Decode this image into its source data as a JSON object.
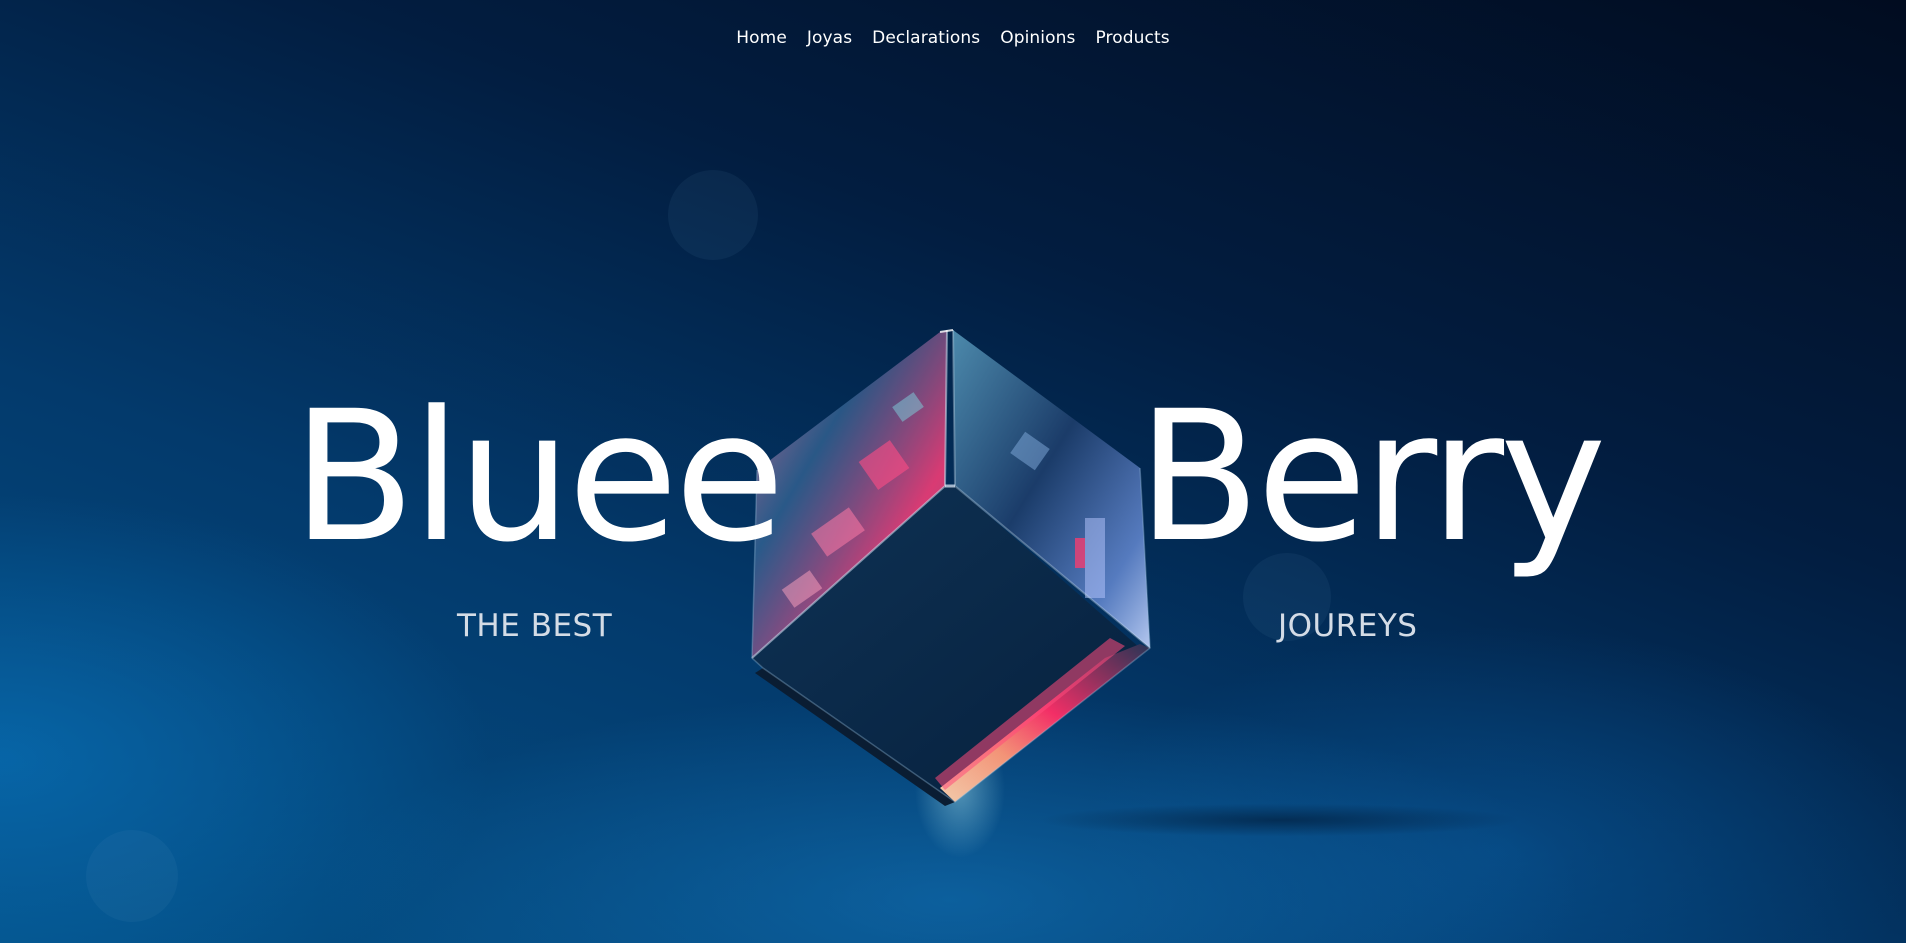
{
  "nav": {
    "items": [
      {
        "label": "Home"
      },
      {
        "label": "Joyas"
      },
      {
        "label": "Declarations"
      },
      {
        "label": "Opinions"
      },
      {
        "label": "Products"
      }
    ]
  },
  "hero": {
    "title_left": "Bluee",
    "title_right": "Berry",
    "subtitle_left": "THE BEST",
    "subtitle_right": "JOUREYS",
    "graphic": "glass-cube-icon"
  },
  "colors": {
    "background_dark": "#010c20",
    "background_light": "#045188",
    "text": "#ffffff",
    "subtitle": "#d4dce6",
    "cube_accent_pink": "#ff2a6a",
    "cube_accent_peach": "#ffb08a"
  }
}
